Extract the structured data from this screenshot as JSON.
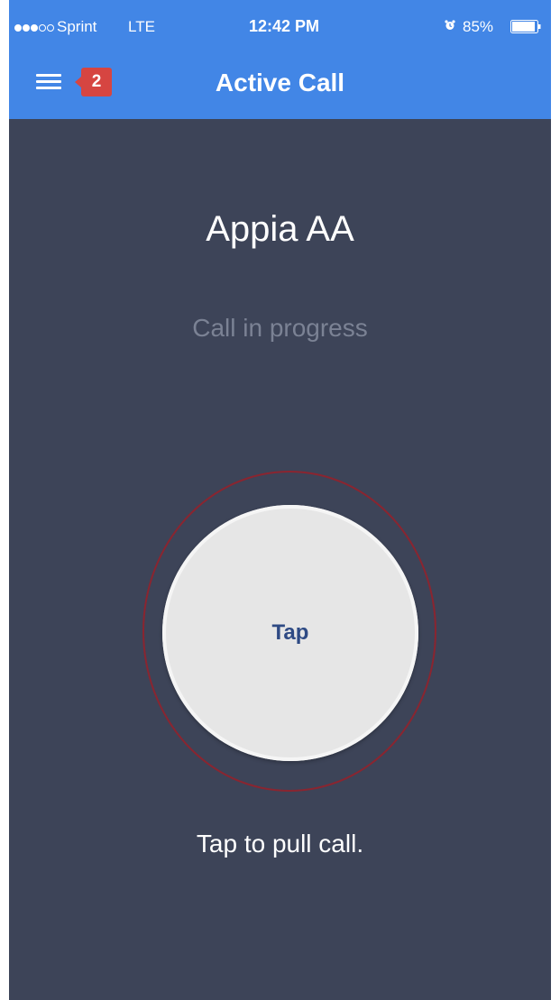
{
  "status_bar": {
    "signal_filled": 3,
    "signal_total": 5,
    "carrier": "Sprint",
    "network": "LTE",
    "time": "12:42 PM",
    "alarm_icon": "alarm-clock-icon",
    "battery_percent": "85%",
    "battery_level": 0.85
  },
  "nav": {
    "menu_icon": "hamburger-menu-icon",
    "badge_count": "2",
    "title": "Active Call"
  },
  "call": {
    "contact_name": "Appia AA",
    "status": "Call in progress",
    "tap_label": "Tap",
    "instruction": "Tap to pull call."
  },
  "colors": {
    "nav_background": "#4286e6",
    "screen_background": "#3d4458",
    "badge": "#d64541",
    "ring": "#8a2530",
    "button": "#e6e6e6",
    "tap_text": "#2e4a84"
  }
}
